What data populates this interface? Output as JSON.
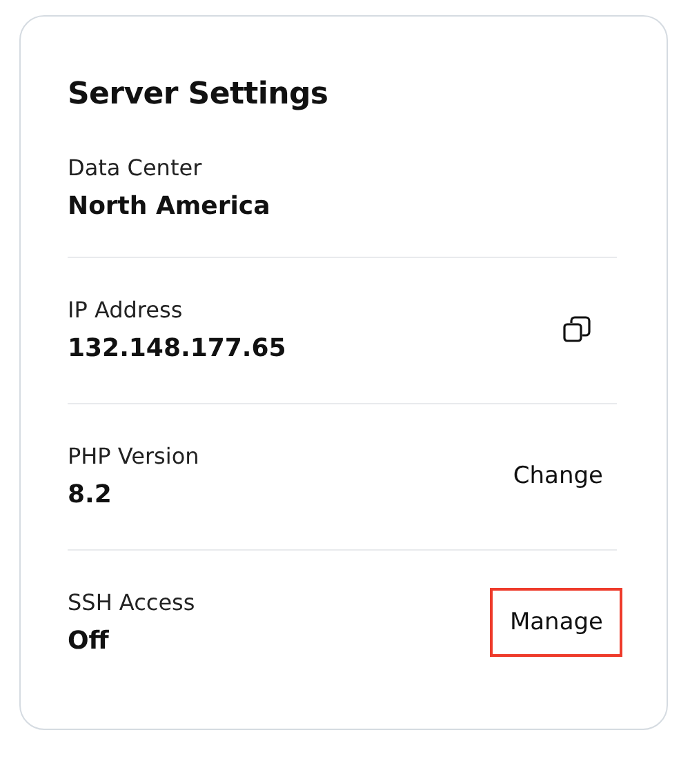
{
  "card": {
    "title": "Server Settings"
  },
  "settings": [
    {
      "label": "Data Center",
      "value": "North America"
    },
    {
      "label": "IP Address",
      "value": "132.148.177.65",
      "action": {
        "kind": "copy",
        "highlighted": false
      }
    },
    {
      "label": "PHP Version",
      "value": "8.2",
      "action": {
        "kind": "text",
        "text": "Change",
        "highlighted": false
      }
    },
    {
      "label": "SSH Access",
      "value": "Off",
      "action": {
        "kind": "text",
        "text": "Manage",
        "highlighted": true
      }
    }
  ]
}
